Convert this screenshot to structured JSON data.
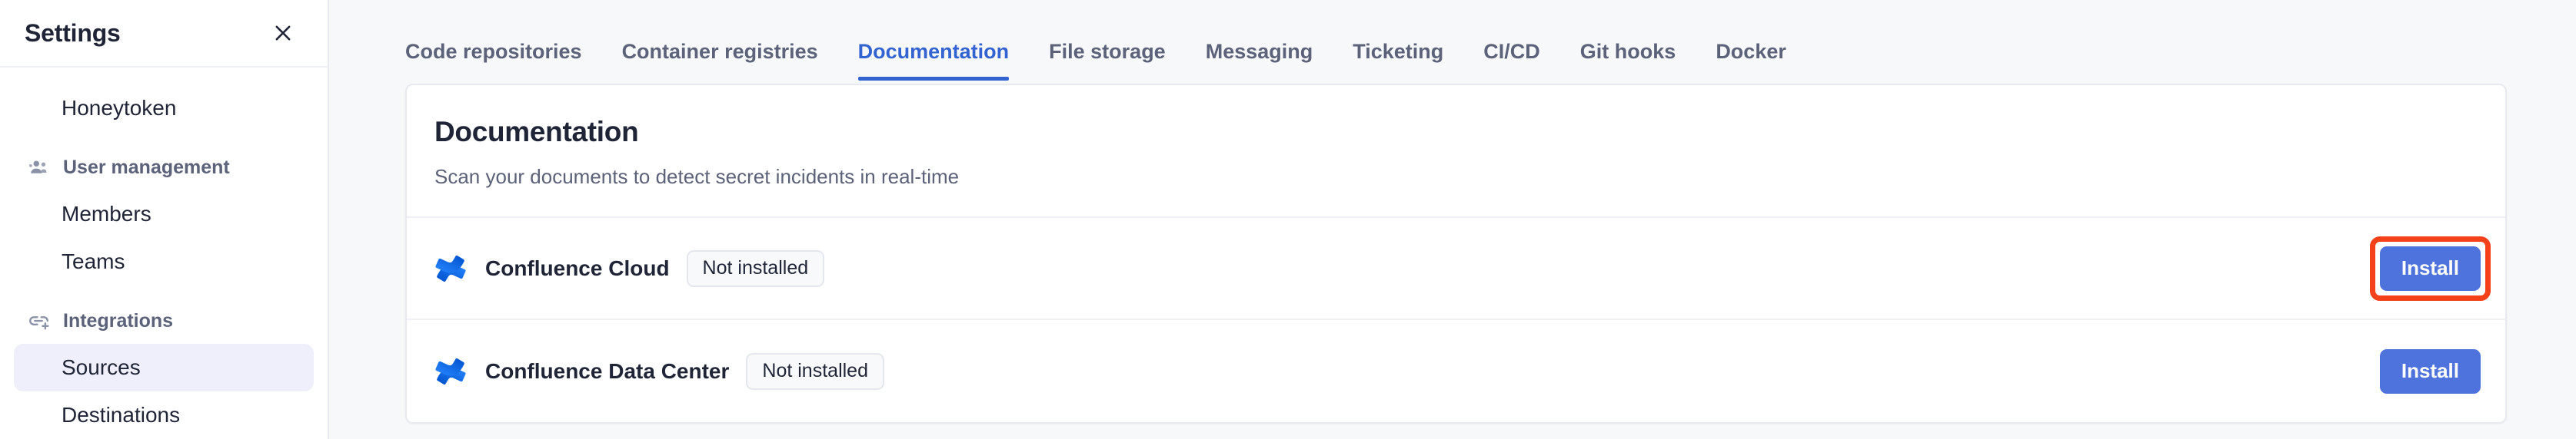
{
  "sidebar": {
    "title": "Settings",
    "close_icon": "close-icon",
    "items": [
      {
        "label": "Honeytoken",
        "type": "link",
        "active": false,
        "icon": null
      },
      {
        "label": "User management",
        "type": "group",
        "active": false,
        "icon": "users-icon"
      },
      {
        "label": "Members",
        "type": "link",
        "active": false,
        "icon": null
      },
      {
        "label": "Teams",
        "type": "link",
        "active": false,
        "icon": null
      },
      {
        "label": "Integrations",
        "type": "group",
        "active": false,
        "icon": "link-plus-icon"
      },
      {
        "label": "Sources",
        "type": "link",
        "active": true,
        "icon": null
      },
      {
        "label": "Destinations",
        "type": "link",
        "active": false,
        "icon": null
      }
    ]
  },
  "tabs": [
    {
      "label": "Code repositories",
      "active": false
    },
    {
      "label": "Container registries",
      "active": false
    },
    {
      "label": "Documentation",
      "active": true
    },
    {
      "label": "File storage",
      "active": false
    },
    {
      "label": "Messaging",
      "active": false
    },
    {
      "label": "Ticketing",
      "active": false
    },
    {
      "label": "CI/CD",
      "active": false
    },
    {
      "label": "Git hooks",
      "active": false
    },
    {
      "label": "Docker",
      "active": false
    }
  ],
  "card": {
    "title": "Documentation",
    "subtitle": "Scan your documents to detect secret incidents in real-time",
    "integrations": [
      {
        "name": "Confluence Cloud",
        "icon": "confluence-icon",
        "status": "Not installed",
        "action_label": "Install",
        "highlighted": true
      },
      {
        "name": "Confluence Data Center",
        "icon": "confluence-icon",
        "status": "Not installed",
        "action_label": "Install",
        "highlighted": false
      }
    ]
  },
  "colors": {
    "accent": "#3263d0",
    "button": "#4f73dd",
    "highlight": "#f4411a",
    "active_nav_bg": "#eeeffa",
    "page_bg": "#f7f8fa",
    "text": "#1f2437",
    "muted_text": "#5b6279"
  }
}
